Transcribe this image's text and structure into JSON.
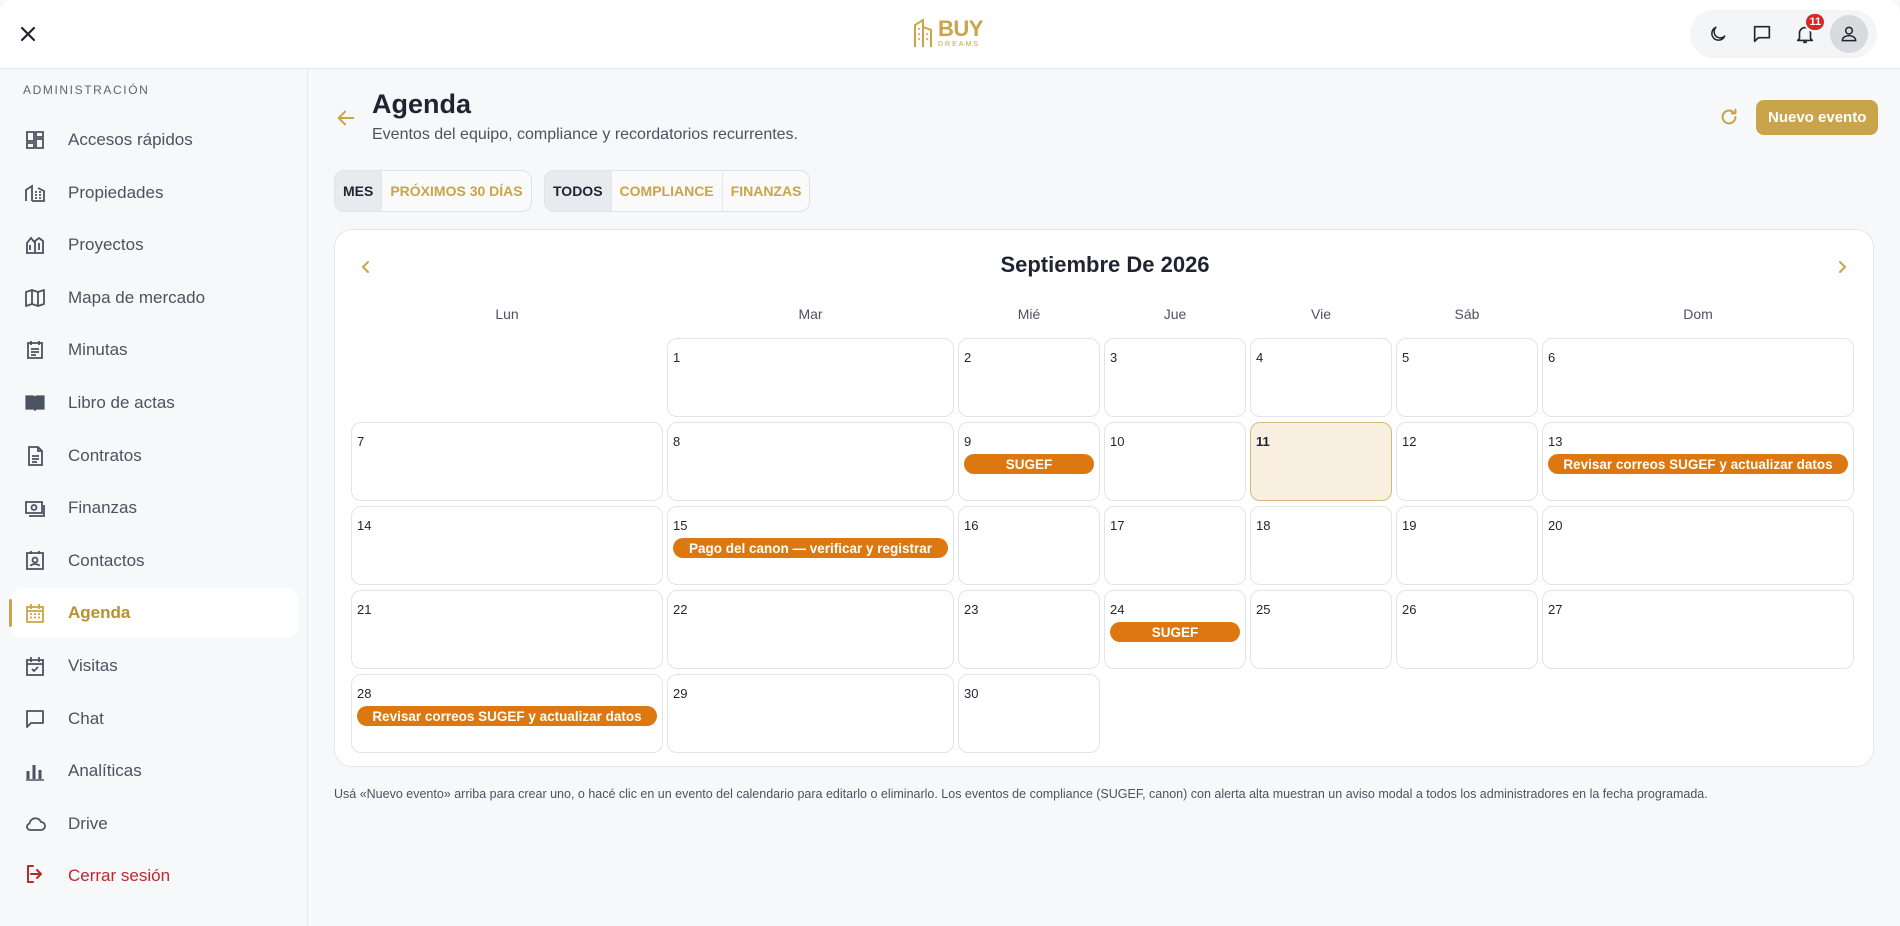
{
  "topbar": {
    "logo_main": "BUY",
    "logo_sub": "DREAMS",
    "notification_count": "11",
    "icons": [
      "close-icon",
      "moon-icon",
      "chat-icon",
      "bell-icon",
      "user-icon"
    ]
  },
  "sidebar": {
    "section_title": "ADMINISTRACIÓN",
    "items": [
      {
        "label": "Accesos rápidos",
        "icon": "grid-icon"
      },
      {
        "label": "Propiedades",
        "icon": "buildings-icon"
      },
      {
        "label": "Proyectos",
        "icon": "project-building-icon"
      },
      {
        "label": "Mapa de mercado",
        "icon": "map-icon"
      },
      {
        "label": "Minutas",
        "icon": "notes-icon"
      },
      {
        "label": "Libro de actas",
        "icon": "book-icon"
      },
      {
        "label": "Contratos",
        "icon": "document-icon"
      },
      {
        "label": "Finanzas",
        "icon": "money-icon"
      },
      {
        "label": "Contactos",
        "icon": "contact-card-icon"
      },
      {
        "label": "Agenda",
        "icon": "calendar-icon",
        "active": true
      },
      {
        "label": "Visitas",
        "icon": "calendar-check-icon"
      },
      {
        "label": "Chat",
        "icon": "chat-bubble-icon"
      },
      {
        "label": "Analíticas",
        "icon": "bar-chart-icon"
      },
      {
        "label": "Drive",
        "icon": "cloud-icon"
      }
    ],
    "logout_label": "Cerrar sesión"
  },
  "main": {
    "title": "Agenda",
    "subtitle": "Eventos del equipo, compliance y recordatorios recurrentes.",
    "new_event_label": "Nuevo evento",
    "view_tabs": [
      {
        "label": "MES",
        "selected": true
      },
      {
        "label": "PRÓXIMOS 30 DÍAS",
        "selected": false
      }
    ],
    "filter_tabs": [
      {
        "label": "TODOS",
        "selected": true
      },
      {
        "label": "COMPLIANCE",
        "selected": false
      },
      {
        "label": "FINANZAS",
        "selected": false
      }
    ],
    "footnote": "Usá «Nuevo evento» arriba para crear uno, o hacé clic en un evento del calendario para editarlo o eliminarlo. Los eventos de compliance (SUGEF, canon) con alerta alta muestran un aviso modal a todos los administradores en la fecha programada."
  },
  "calendar": {
    "title": "Septiembre De 2026",
    "weekdays": [
      "Lun",
      "Mar",
      "Mié",
      "Jue",
      "Vie",
      "Sáb",
      "Dom"
    ],
    "today": 11,
    "days_in_month": 30,
    "first_weekday_index": 1,
    "event_color": "#dc780f",
    "today_bg": "#f8efe0",
    "accent": "#c9a44a",
    "events": [
      {
        "day": 9,
        "label": "SUGEF"
      },
      {
        "day": 13,
        "label": "Revisar correos SUGEF y actualizar datos"
      },
      {
        "day": 15,
        "label": "Pago del canon — verificar y registrar"
      },
      {
        "day": 24,
        "label": "SUGEF"
      },
      {
        "day": 28,
        "label": "Revisar correos SUGEF y actualizar datos"
      }
    ]
  }
}
